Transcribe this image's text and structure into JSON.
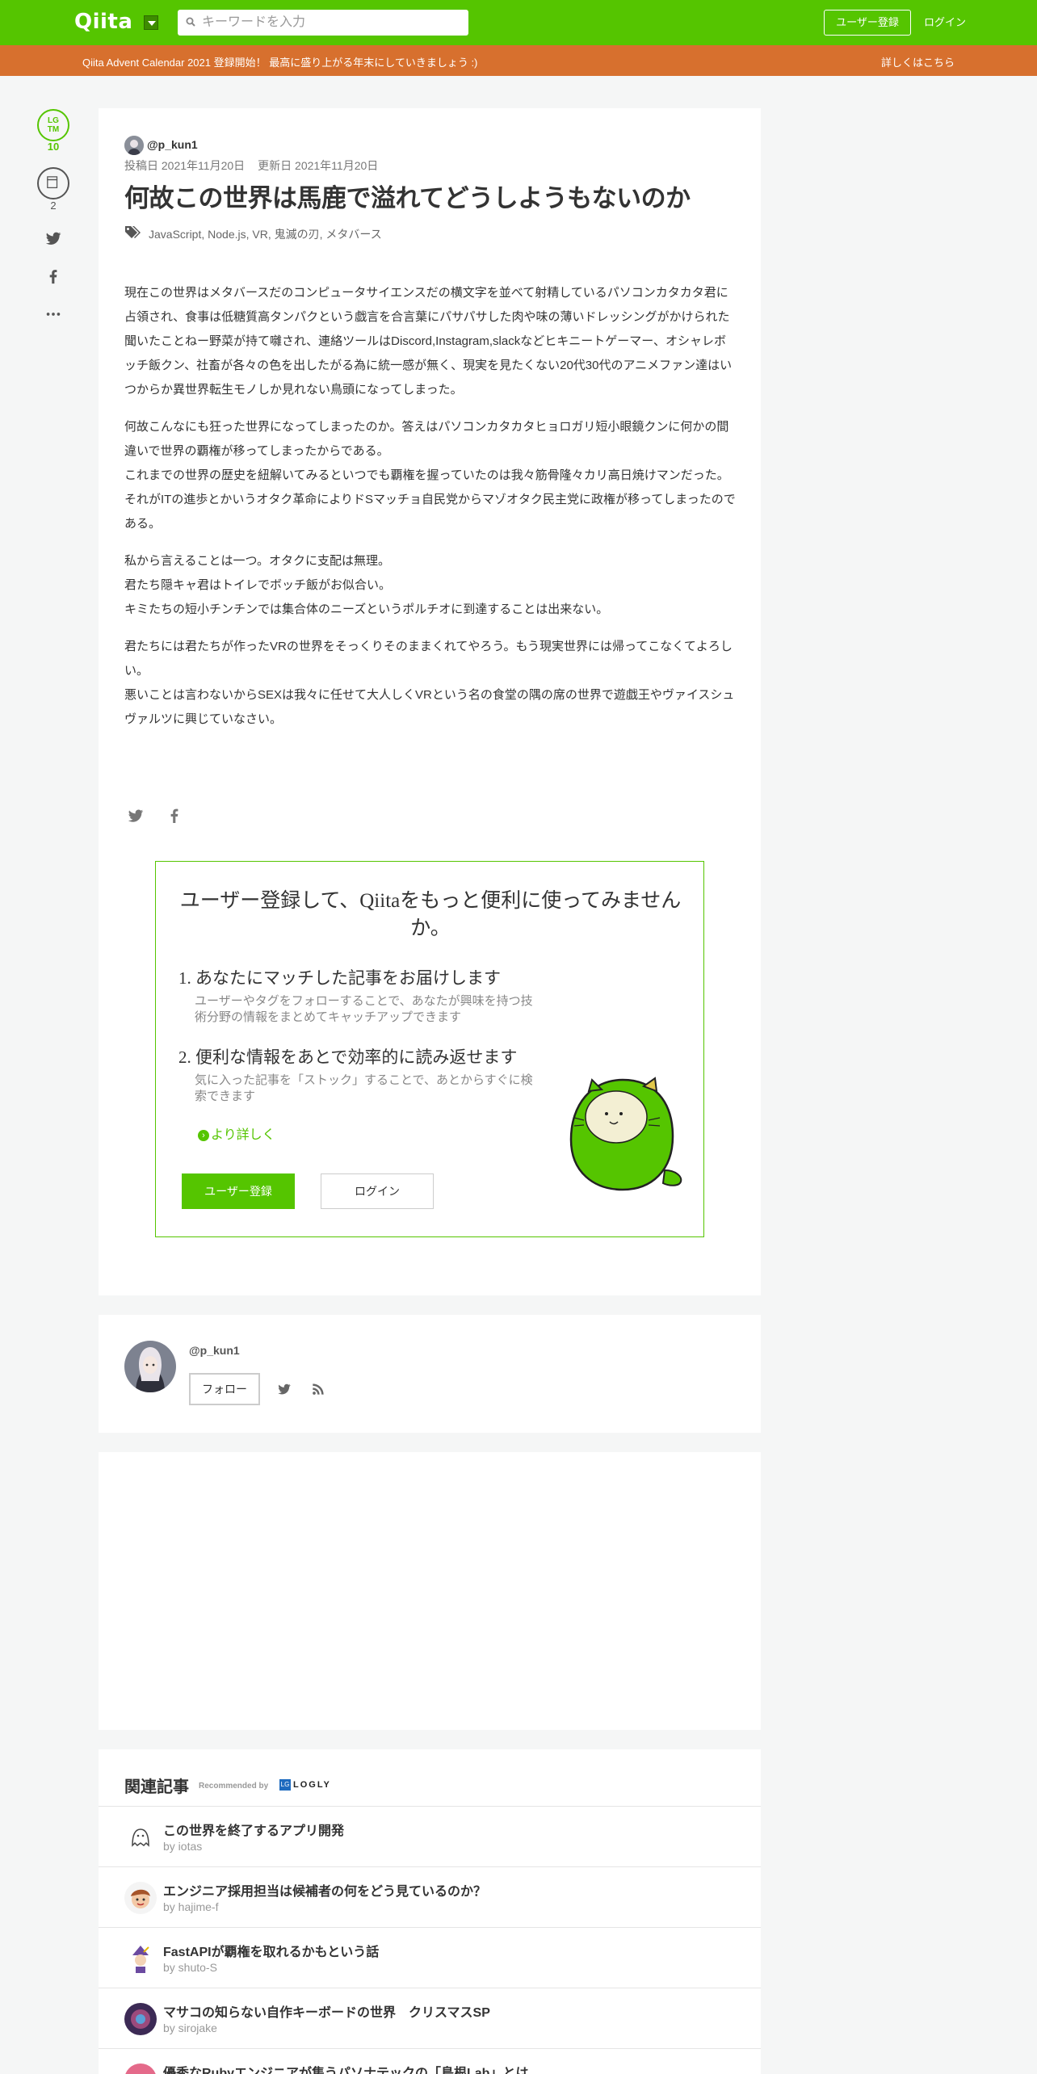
{
  "header": {
    "logo": "Qiita",
    "search_placeholder": "キーワードを入力",
    "register_label": "ユーザー登録",
    "login_label": "ログイン",
    "brand_color": "#55c500"
  },
  "banner": {
    "text": "Qiita Advent Calendar 2021 登録開始！ 最高に盛り上がる年末にしていきましょう :)",
    "link": "詳しくはこちら",
    "color": "#d7702e"
  },
  "rail": {
    "lgtm_label": "LGTM",
    "lgtm_count": "10",
    "stock_count": "2"
  },
  "article": {
    "author": "@p_kun1",
    "posted": "投稿日 2021年11月20日",
    "updated": "更新日 2021年11月20日",
    "title": "何故この世界は馬鹿で溢れてどうしようもないのか",
    "tags": "JavaScript,  Node.js,  VR,  鬼滅の刃,  メタバース",
    "paragraphs": [
      "現在この世界はメタバースだのコンピュータサイエンスだの横文字を並べて射精しているパソコンカタカタ君に占領され、食事は低糖質高タンパクという戯言を合言葉にパサパサした肉や味の薄いドレッシングがかけられた聞いたことねー野菜が持て囃され、連絡ツールはDiscord,Instagram,slackなどヒキニートゲーマー、オシャレボッチ飯クン、社畜が各々の色を出したがる為に統一感が無く、現実を見たくない20代30代のアニメファン達はいつからか異世界転生モノしか見れない鳥頭になってしまった。",
      "何故こんなにも狂った世界になってしまったのか。答えはパソコンカタカタヒョロガリ短小眼鏡クンに何かの間違いで世界の覇権が移ってしまったからである。\nこれまでの世界の歴史を紐解いてみるといつでも覇権を握っていたのは我々筋骨隆々カリ高日焼けマンだった。\nそれがITの進歩とかいうオタク革命によりドSマッチョ自民党からマゾオタク民主党に政権が移ってしまったのである。",
      "私から言えることは一つ。オタクに支配は無理。\n君たち隠キャ君はトイレでボッチ飯がお似合い。\nキミたちの短小チンチンでは集合体のニーズというポルチオに到達することは出来ない。",
      "君たちには君たちが作ったVRの世界をそっくりそのままくれてやろう。もう現実世界には帰ってこなくてよろしい。\n悪いことは言わないからSEXは我々に任せて大人しくVRという名の食堂の隅の席の世界で遊戯王やヴァイスシュヴァルツに興じていなさい。"
    ]
  },
  "signup": {
    "title": "ユーザー登録して、Qiitaをもっと便利に使ってみませんか。",
    "items": [
      {
        "head": "1. あなたにマッチした記事をお届けします",
        "desc": "ユーザーやタグをフォローすることで、あなたが興味を持つ技術分野の情報をまとめてキャッチアップできます"
      },
      {
        "head": "2. 便利な情報をあとで効率的に読み返せます",
        "desc": "気に入った記事を「ストック」することで、あとからすぐに検索できます"
      }
    ],
    "more": "より詳しく",
    "register_label": "ユーザー登録",
    "login_label": "ログイン"
  },
  "author_card": {
    "name": "@p_kun1",
    "follow_label": "フォロー"
  },
  "related": {
    "title": "関連記事",
    "recommended_by": "Recommended by",
    "logly": "LOGLY",
    "logly_mark": "LG",
    "items": [
      {
        "title": "この世界を終了するアプリ開発",
        "by": "by iotas"
      },
      {
        "title": "エンジニア採用担当は候補者の何をどう見ているのか？",
        "by": "by hajime-f"
      },
      {
        "title": "FastAPIが覇権を取れるかもという話",
        "by": "by shuto-S"
      },
      {
        "title": "マサコの知らない自作キーボードの世界　クリスマスSP",
        "by": "by sirojake"
      },
      {
        "title": "優秀なRubyエンジニアが集うパソナテックの「島根Lab」とは",
        "by": ""
      }
    ]
  }
}
